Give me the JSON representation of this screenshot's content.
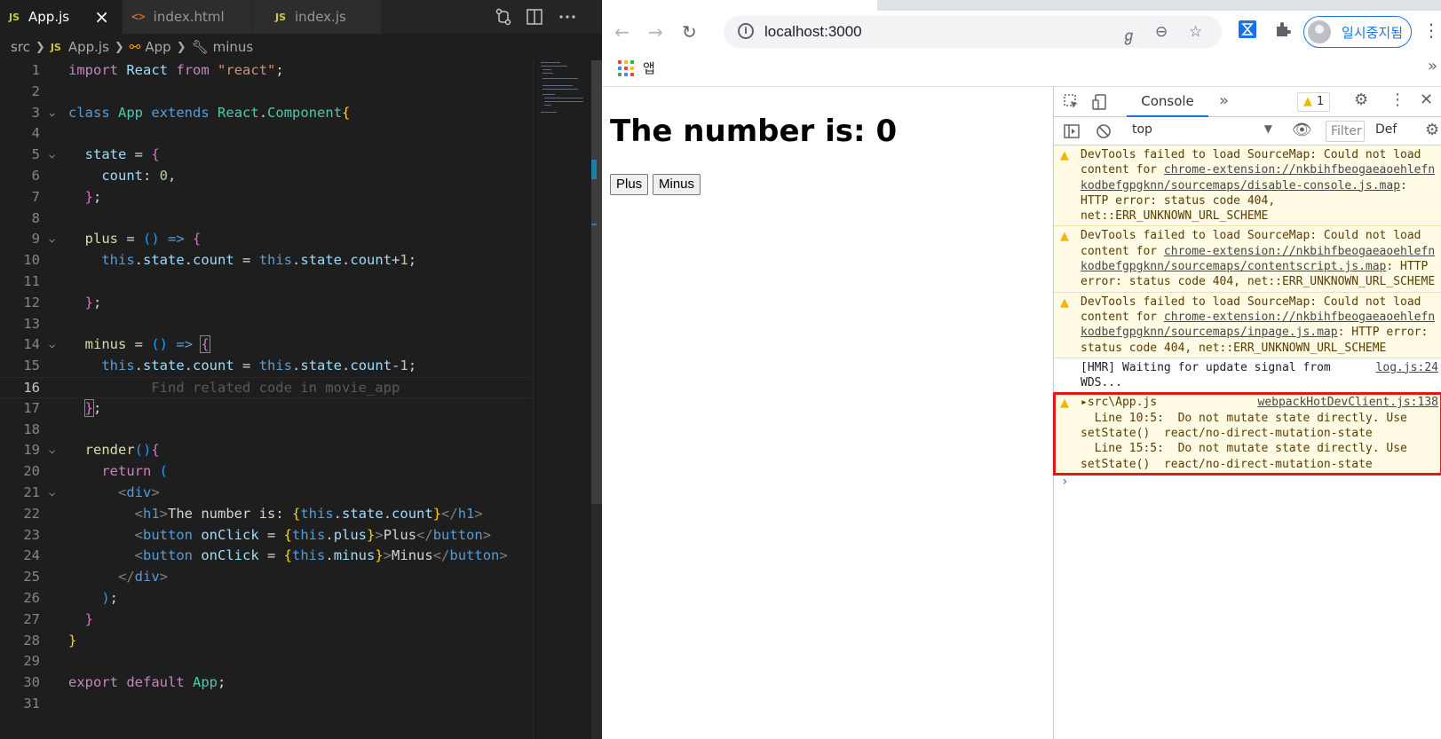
{
  "editor": {
    "tabs": [
      {
        "label": "App.js",
        "icon": "JS",
        "active": true
      },
      {
        "label": "index.html",
        "icon": "<>",
        "active": false
      },
      {
        "label": "index.js",
        "icon": "JS",
        "active": false
      }
    ],
    "breadcrumb": [
      "src",
      "App.js",
      "App",
      "minus"
    ],
    "ghost_text": "Find related code in movie_app",
    "line_numbers": [
      "1",
      "2",
      "3",
      "4",
      "5",
      "6",
      "7",
      "8",
      "9",
      "10",
      "11",
      "12",
      "13",
      "14",
      "15",
      "16",
      "17",
      "18",
      "19",
      "20",
      "21",
      "22",
      "23",
      "24",
      "25",
      "26",
      "27",
      "28",
      "29",
      "30",
      "31"
    ],
    "current_line": "16"
  },
  "browser": {
    "url": "localhost:3000",
    "bookmark_label": "앱",
    "profile_label": "일시중지됨"
  },
  "page": {
    "heading": "The number is: 0",
    "plus_label": "Plus",
    "minus_label": "Minus"
  },
  "devtools": {
    "console_tab": "Console",
    "warning_count": "1",
    "context": "top",
    "filter_placeholder": "Filter",
    "levels": "Def",
    "messages": [
      {
        "pre": "DevTools failed to load SourceMap: Could not load content for ",
        "link": "chrome-extension://nkbihfbeogaeaoehlefnkodbefgpgknn/sourcemaps/disable-console.js.map",
        "post": ": HTTP error: status code 404, net::ERR_UNKNOWN_URL_SCHEME"
      },
      {
        "pre": "DevTools failed to load SourceMap: Could not load content for ",
        "link": "chrome-extension://nkbihfbeogaeaoehlefnkodbefgpgknn/sourcemaps/contentscript.js.map",
        "post": ": HTTP error: status code 404, net::ERR_UNKNOWN_URL_SCHEME"
      },
      {
        "pre": "DevTools failed to load SourceMap: Could not load content for ",
        "link": "chrome-extension://nkbihfbeogaeaoehlefnkodbefgpgknn/sourcemaps/inpage.js.map",
        "post": ": HTTP error: status code 404, net::ERR_UNKNOWN_URL_SCHEME"
      }
    ],
    "hmr_text": "[HMR] Waiting for update signal from WDS...",
    "hmr_source": "log.js:24",
    "eslint_file": "src\\App.js",
    "eslint_source": "webpackHotDevClient.js:138",
    "eslint_line1": "  Line 10:5:  Do not mutate state directly. Use setState()  react/no-direct-mutation-state",
    "eslint_line2": "  Line 15:5:  Do not mutate state directly. Use setState()  react/no-direct-mutation-state"
  }
}
